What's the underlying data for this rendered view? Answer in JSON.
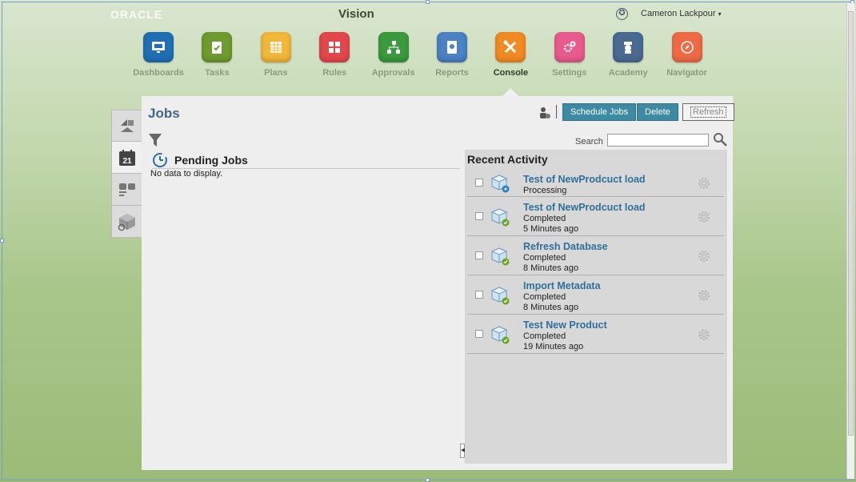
{
  "header": {
    "brand": "ORACLE",
    "app_title": "Vision",
    "user_name": "Cameron Lackpour",
    "user_caret": "▾",
    "accessibility_glyph": "✪"
  },
  "nav": [
    {
      "label": "Dashboards",
      "color": "#1f6fb5",
      "icon": "monitor-icon",
      "active": false
    },
    {
      "label": "Tasks",
      "color": "#6f9a2f",
      "icon": "clipboard-check-icon",
      "active": false
    },
    {
      "label": "Plans",
      "color": "#f0b73a",
      "icon": "grid-icon",
      "active": false
    },
    {
      "label": "Rules",
      "color": "#e2474c",
      "icon": "calculator-icon",
      "active": false
    },
    {
      "label": "Approvals",
      "color": "#3a9a3d",
      "icon": "hierarchy-icon",
      "active": false
    },
    {
      "label": "Reports",
      "color": "#4a82c2",
      "icon": "report-icon",
      "active": false
    },
    {
      "label": "Console",
      "color": "#f28a22",
      "icon": "tools-icon",
      "active": true
    },
    {
      "label": "Settings",
      "color": "#e85a8c",
      "icon": "gears-icon",
      "active": false
    },
    {
      "label": "Academy",
      "color": "#4a6a92",
      "icon": "academy-icon",
      "active": false
    },
    {
      "label": "Navigator",
      "color": "#ee6a45",
      "icon": "compass-icon",
      "active": false
    }
  ],
  "vertical_tabs": [
    "overview-tab",
    "jobs-calendar-tab",
    "layout-tab",
    "dimensions-tab"
  ],
  "calendar_day": "21",
  "panel": {
    "title": "Jobs",
    "schedule_label": "Schedule Jobs",
    "delete_label": "Delete",
    "refresh_label": "Refresh",
    "search_label": "Search",
    "search_value": ""
  },
  "pending": {
    "title": "Pending Jobs",
    "empty_text": "No data to display."
  },
  "activity": {
    "title": "Recent Activity",
    "items": [
      {
        "name": "Test of NewProdcuct load",
        "status": "Processing",
        "time": "",
        "state": "processing"
      },
      {
        "name": "Test of NewProdcuct load",
        "status": "Completed",
        "time": "5 Minutes ago",
        "state": "completed"
      },
      {
        "name": "Refresh Database",
        "status": "Completed",
        "time": "8 Minutes ago",
        "state": "completed"
      },
      {
        "name": "Import Metadata",
        "status": "Completed",
        "time": "8 Minutes ago",
        "state": "completed"
      },
      {
        "name": "Test New Product",
        "status": "Completed",
        "time": "19 Minutes ago",
        "state": "completed"
      }
    ]
  }
}
